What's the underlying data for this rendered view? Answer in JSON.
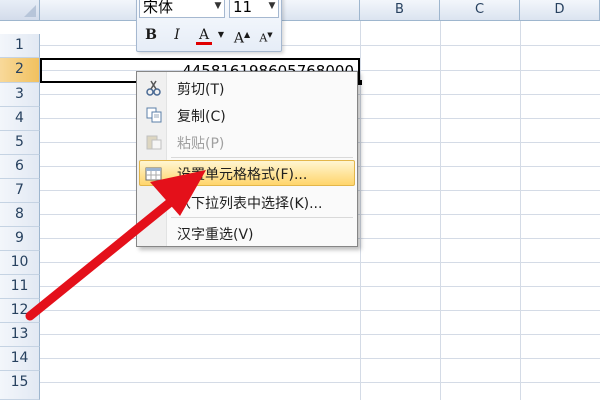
{
  "columns": [
    "B",
    "C",
    "D"
  ],
  "rows": [
    "1",
    "2",
    "3",
    "4",
    "5",
    "6",
    "7",
    "8",
    "9",
    "10",
    "11",
    "12",
    "13",
    "14",
    "15"
  ],
  "cell_a2": "445816198605768000",
  "mini_toolbar": {
    "font_name": "宋体",
    "font_size": "11",
    "bold": "B",
    "italic": "I",
    "font_color": "A",
    "grow_font": "A",
    "shrink_font": "A"
  },
  "context_menu": {
    "items": [
      {
        "label": "剪切(T)",
        "icon": "scissors-icon",
        "enabled": true
      },
      {
        "label": "复制(C)",
        "icon": "copy-icon",
        "enabled": true
      },
      {
        "label": "粘贴(P)",
        "icon": "paste-icon",
        "enabled": false
      },
      {
        "label": "设置单元格格式(F)...",
        "icon": "format-cells-icon",
        "enabled": true,
        "highlighted": true
      },
      {
        "label": "从下拉列表中选择(K)...",
        "icon": "",
        "enabled": true
      },
      {
        "label": "汉字重选(V)",
        "icon": "",
        "enabled": true
      }
    ]
  },
  "colors": {
    "header_text": "#27415f",
    "grid": "#d4dbe6",
    "highlight": "#ffd56c",
    "annotation_arrow": "#e4101a",
    "font_color_bar": "#e00000"
  }
}
